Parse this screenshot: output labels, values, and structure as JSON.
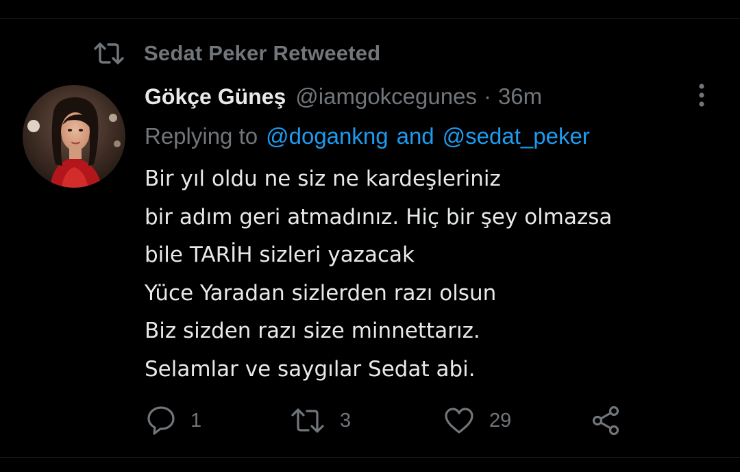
{
  "retweet": {
    "icon": "retweet-icon",
    "label": "Sedat Peker Retweeted"
  },
  "tweet": {
    "avatar_icon": "profile-photo",
    "author_name": "Gökçe Güneş",
    "author_handle": "@iamgokcegunes",
    "separator": "·",
    "timestamp": "36m",
    "replying_prefix": "Replying to",
    "mention_1": "@dogankng",
    "mention_joiner": "and",
    "mention_2": "@sedat_peker",
    "body_lines": [
      "Bir yıl oldu ne siz ne kardeşleriniz",
      "bir adım geri atmadınız. Hiç bir şey olmazsa",
      "bile TARİH sizleri yazacak",
      "Yüce Yaradan sizlerden razı olsun",
      "Biz sizden razı size minnettarız.",
      "Selamlar ve saygılar Sedat abi."
    ]
  },
  "actions": {
    "reply_count": "1",
    "retweet_count": "3",
    "like_count": "29"
  },
  "colors": {
    "background": "#000000",
    "primary_text": "#e7e9ea",
    "secondary_text": "#71767b",
    "link": "#1d9bf0",
    "divider": "#1f2326"
  }
}
